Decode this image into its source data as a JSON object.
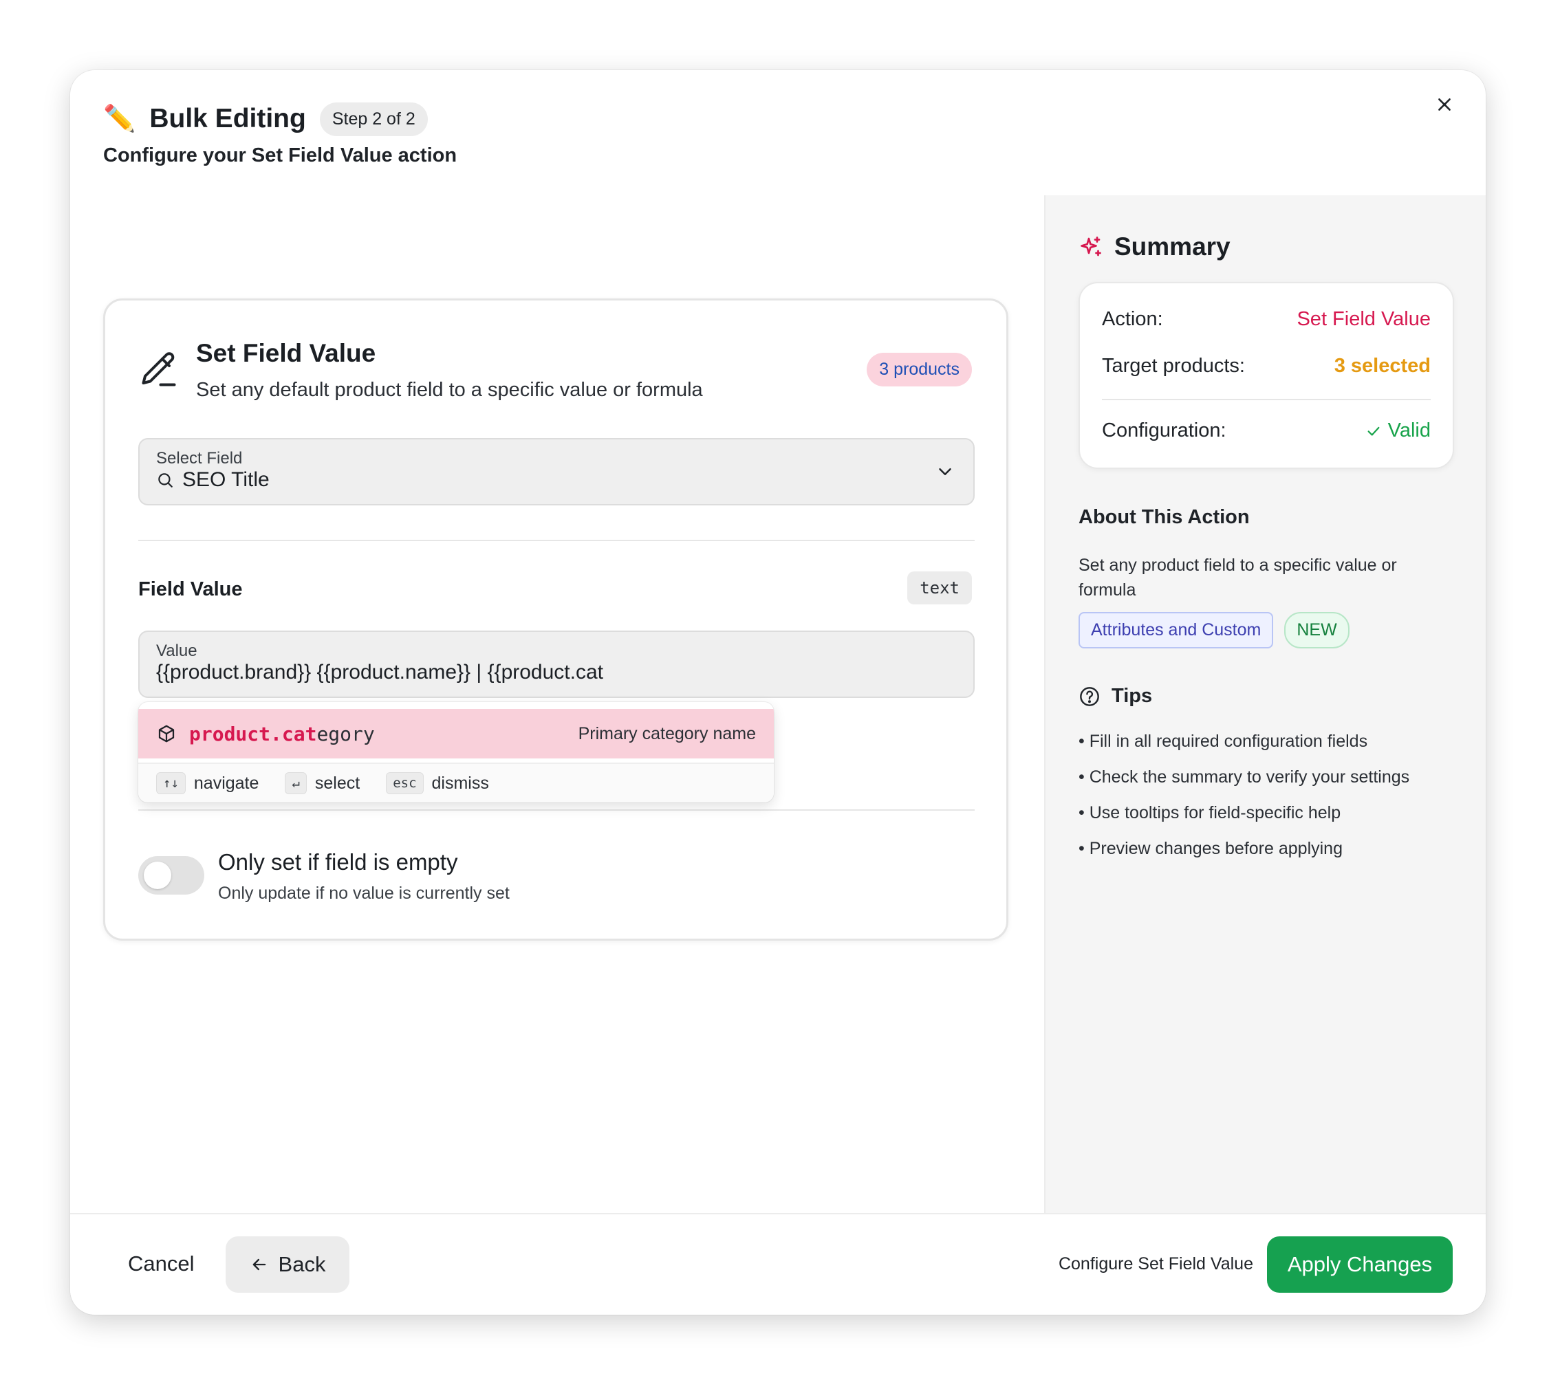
{
  "header": {
    "title": "Bulk Editing",
    "step": "Step 2 of 2",
    "subtitle_prefix": "Configure your",
    "subtitle_action": "Set Field Value",
    "subtitle_suffix": "action"
  },
  "card": {
    "title": "Set Field Value",
    "description": "Set any default product field to a specific value or formula",
    "products_badge": "3 products",
    "select_field": {
      "label": "Select Field",
      "value": "SEO Title"
    },
    "field_value_label": "Field Value",
    "type_badge": "text",
    "value_field": {
      "label": "Value",
      "value": "{{product.brand}} {{product.name}} | {{product.cat"
    },
    "autocomplete": {
      "item_match": "product.cat",
      "item_rest": "egory",
      "item_desc": "Primary category name",
      "hints": [
        {
          "key": "↑↓",
          "label": "navigate"
        },
        {
          "key": "↵",
          "label": "select"
        },
        {
          "key": "esc",
          "label": "dismiss"
        }
      ]
    },
    "toggle": {
      "label": "Only set if field is empty",
      "description": "Only update if no value is currently set",
      "on": false
    }
  },
  "summary": {
    "title": "Summary",
    "rows": [
      {
        "label": "Action:",
        "value": "Set Field Value"
      },
      {
        "label": "Target products:",
        "value": "3 selected"
      },
      {
        "label": "Configuration:",
        "value": "Valid"
      }
    ]
  },
  "about": {
    "title": "About This Action",
    "description": "Set any product field to a specific value or formula",
    "tags": [
      "Attributes and Custom",
      "NEW"
    ]
  },
  "tips": {
    "title": "Tips",
    "items": [
      "• Fill in all required configuration fields",
      "• Check the summary to verify your settings",
      "• Use tooltips for field-specific help",
      "• Preview changes before applying"
    ]
  },
  "footer": {
    "cancel": "Cancel",
    "back": "Back",
    "hint": "Configure Set Field Value",
    "apply": "Apply Changes"
  },
  "colors": {
    "accent_pink": "#d6184f",
    "amber": "#e59a12",
    "success_green": "#17a34a",
    "apply_green": "#16a150"
  }
}
